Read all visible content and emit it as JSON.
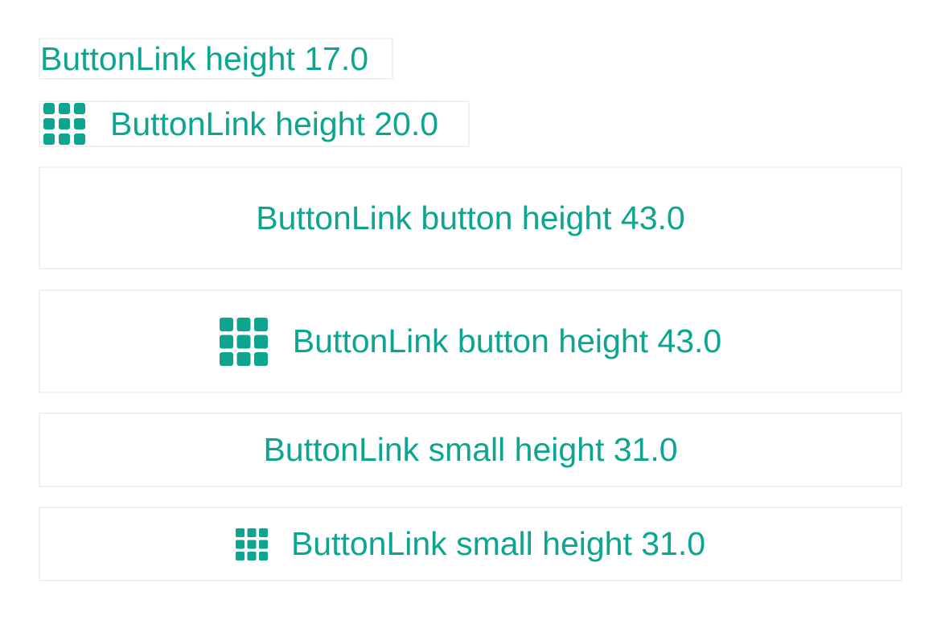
{
  "accent_color": "#0da58f",
  "border_color": "#eef0f1",
  "links": [
    {
      "label": "ButtonLink height 17.0",
      "icon": null
    },
    {
      "label": "ButtonLink height 20.0",
      "icon": "grid-icon"
    }
  ],
  "buttons": [
    {
      "label": "ButtonLink button height 43.0",
      "icon": null
    },
    {
      "label": "ButtonLink button height 43.0",
      "icon": "grid-icon"
    }
  ],
  "small_buttons": [
    {
      "label": "ButtonLink small height 31.0",
      "icon": null
    },
    {
      "label": "ButtonLink small height 31.0",
      "icon": "grid-icon"
    }
  ]
}
